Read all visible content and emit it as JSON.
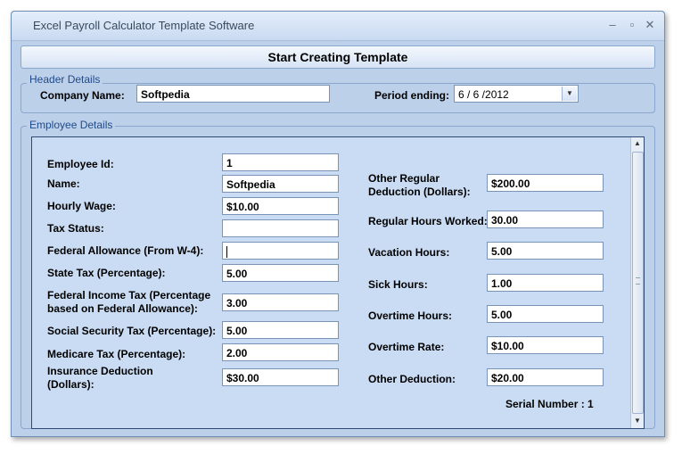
{
  "window": {
    "title": "Excel Payroll Calculator Template Software",
    "minimize": "–",
    "maximize": "▫",
    "close": "✕"
  },
  "toolbar": {
    "start_label": "Start Creating Template"
  },
  "header_details": {
    "legend": "Header Details",
    "company_label": "Company Name:",
    "company_value": "Softpedia",
    "period_label": "Period ending:",
    "period_value": "6 / 6 /2012"
  },
  "employee_details": {
    "legend": "Employee Details",
    "left": {
      "employee_id_label": "Employee Id:",
      "employee_id_value": "1",
      "name_label": "Name:",
      "name_value": "Softpedia",
      "hourly_wage_label": "Hourly Wage:",
      "hourly_wage_value": "$10.00",
      "tax_status_label": "Tax Status:",
      "tax_status_value": "",
      "federal_allowance_label": "Federal Allowance (From W-4):",
      "federal_allowance_value": "",
      "state_tax_label": "State Tax (Percentage):",
      "state_tax_value": "5.00",
      "federal_income_tax_label_1": "Federal Income Tax (Percentage",
      "federal_income_tax_label_2": "based on Federal Allowance):",
      "federal_income_tax_value": "3.00",
      "social_security_label": "Social Security Tax (Percentage):",
      "social_security_value": "5.00",
      "medicare_label": "Medicare Tax (Percentage):",
      "medicare_value": "2.00",
      "insurance_label_1": "Insurance Deduction",
      "insurance_label_2": "(Dollars):",
      "insurance_value": "$30.00"
    },
    "right": {
      "other_regular_label_1": "Other Regular",
      "other_regular_label_2": "Deduction (Dollars):",
      "other_regular_value": "$200.00",
      "regular_hours_label": "Regular Hours Worked:",
      "regular_hours_value": "30.00",
      "vacation_label": "Vacation Hours:",
      "vacation_value": "5.00",
      "sick_label": "Sick Hours:",
      "sick_value": "1.00",
      "overtime_hours_label": "Overtime Hours:",
      "overtime_hours_value": "5.00",
      "overtime_rate_label": "Overtime Rate:",
      "overtime_rate_value": "$10.00",
      "other_deduction_label": "Other Deduction:",
      "other_deduction_value": "$20.00"
    },
    "serial_number": "Serial Number : 1"
  },
  "scrollbar": {
    "up": "▲",
    "down": "▼"
  }
}
